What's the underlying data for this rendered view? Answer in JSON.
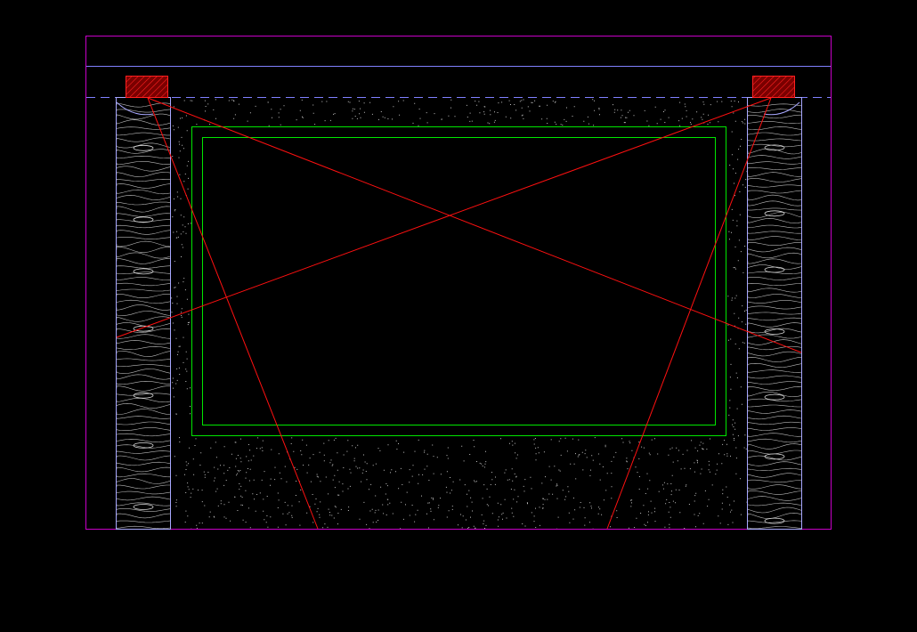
{
  "drawing": {
    "background": "#000000",
    "colors": {
      "frame": "#c800c8",
      "guide": "#8080ff",
      "column": "#a8a8ff",
      "panel": "#00e600",
      "cross": "#ff1010",
      "hatch": "#ff2020",
      "block_fill": "#7a0000",
      "speckle": "#ffffff",
      "wood_grain": "#d8d8d8"
    },
    "elements": {
      "outer_frame": "rectangle",
      "beam_line": "line",
      "dashed_guide": "dashed-line",
      "left_column": "wood-grain-column",
      "right_column": "wood-grain-column",
      "stone_infill": "speckled-infill",
      "panel_outer": "rectangle",
      "panel_inner": "rectangle",
      "diagonals": "cross-lines",
      "left_block": "hatched-block",
      "right_block": "hatched-block"
    }
  }
}
